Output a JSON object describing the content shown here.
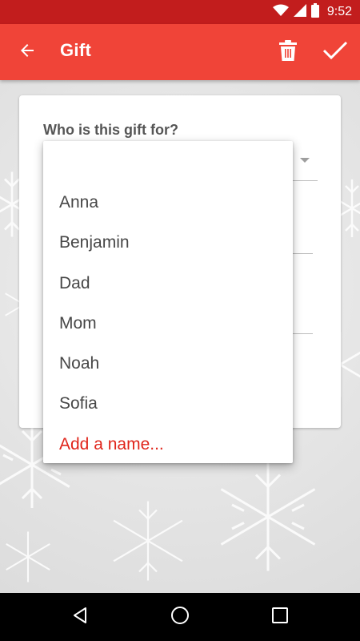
{
  "status_bar": {
    "time": "9:52",
    "icons": [
      "wifi-icon",
      "signal-icon",
      "battery-icon"
    ]
  },
  "app_bar": {
    "title": "Gift",
    "back_icon": "arrow-back-icon",
    "delete_icon": "trash-icon",
    "confirm_icon": "check-icon",
    "color": "#f04438"
  },
  "card": {
    "question": "Who is this gift for?"
  },
  "popup": {
    "items": [
      {
        "label": ""
      },
      {
        "label": "Anna"
      },
      {
        "label": "Benjamin"
      },
      {
        "label": "Dad"
      },
      {
        "label": "Mom"
      },
      {
        "label": "Noah"
      },
      {
        "label": "Sofia"
      }
    ],
    "add_label": "Add a name...",
    "add_color": "#e0251b"
  },
  "nav_bar": {
    "icons": [
      "back-triangle-icon",
      "home-circle-icon",
      "recents-square-icon"
    ]
  }
}
